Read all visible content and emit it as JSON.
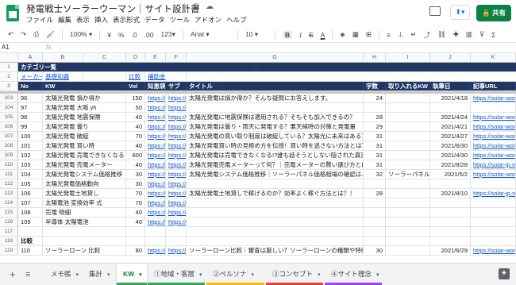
{
  "title": "発電戦士ソーラーウーマン｜サイト設計書",
  "title_icons": [
    "star-icon",
    "move-to-folder-icon",
    "cloud-saved-icon"
  ],
  "menu": [
    "ファイル",
    "編集",
    "表示",
    "挿入",
    "表示形式",
    "データ",
    "ツール",
    "アドオン",
    "ヘルプ"
  ],
  "share_label": "共有",
  "toolbar": {
    "zoom": "100%",
    "currency": "¥",
    "percent": "%",
    "dec_dec": ".0",
    "dec_inc": ".00",
    "format_more": "123",
    "font": "Arial",
    "font_size": "10",
    "bold": "B",
    "italic": "I",
    "strike": "S",
    "text_color": "A"
  },
  "name_box": "A1",
  "fx": "fx",
  "columns": [
    "A",
    "B",
    "C",
    "D",
    "E",
    "F",
    "G",
    "H",
    "I",
    "J",
    "K"
  ],
  "top_rows": {
    "r1": {
      "num": "1",
      "label": "カテゴリ一覧"
    },
    "r2": {
      "num": "2",
      "c1": "メーカー",
      "c2": "基礎知識",
      "c3": "比較",
      "c4": "補助金"
    },
    "r3": {
      "num": "3",
      "cells": [
        "No",
        "KW",
        "Vol",
        "知恵袋",
        "サブ",
        "タイトル",
        "字数",
        "取り入れるKW",
        "執筆日",
        "記事URL"
      ]
    }
  },
  "rows": [
    {
      "num": "103",
      "no": "96",
      "kw": "太陽光発電 損か得か",
      "vol": "150",
      "chie": "https://c",
      "sub": "https://v",
      "title": "太陽光発電は損か得か？そんな疑問にお答えします。",
      "chars": "24",
      "inkw": "",
      "date": "2021/4/18",
      "url": "https://solar-wor"
    },
    {
      "num": "104",
      "no": "97",
      "kw": "太陽光発電 大阪 yh",
      "vol": "50",
      "chie": "https://c",
      "sub": "https://v",
      "title": "",
      "chars": "",
      "inkw": "",
      "date": "",
      "url": ""
    },
    {
      "num": "105",
      "no": "98",
      "kw": "太陽光発電 地震保険",
      "vol": "40",
      "chie": "https://c",
      "sub": "https://v",
      "title": "太陽光発電に地震保険は適用される？そもそも加入できるの？",
      "chars": "28",
      "inkw": "",
      "date": "2021/4/24",
      "url": "https://solar-wor"
    },
    {
      "num": "106",
      "no": "99",
      "kw": "太陽光発電 曇り",
      "vol": "40",
      "chie": "https://c",
      "sub": "https://v",
      "title": "太陽光発電は曇り・雨天に発電する？悪天候時の対策と発電量",
      "chars": "29",
      "inkw": "",
      "date": "2021/4/21",
      "url": "https://solar-wor"
    },
    {
      "num": "107",
      "no": "100",
      "kw": "太陽光発電 破綻",
      "vol": "70",
      "chie": "https://c",
      "sub": "https://v",
      "title": "太陽光発電の買い取り制度は破綻している？太陽光に未来はある？",
      "chars": "31",
      "inkw": "",
      "date": "2021/4/27",
      "url": "https://solar-wor"
    },
    {
      "num": "108",
      "no": "101",
      "kw": "太陽光発電 買い時",
      "vol": "40",
      "chie": "https://c",
      "sub": "https://v",
      "title": "太陽光発電買い時の見極め方を伝授！買い時を逃さない方法とは？",
      "chars": "31",
      "inkw": "",
      "date": "2021/6/30",
      "url": "https://solar-wor"
    },
    {
      "num": "109",
      "no": "102",
      "kw": "太陽光発電 売電できなくなる",
      "vol": "600",
      "chie": "https://c",
      "sub": "https://v",
      "title": "太陽光発電は売電できなくなる!?誰も話そうとしない隠された真実",
      "chars": "31",
      "inkw": "",
      "date": "2021/4/30",
      "url": "https://solar-wor"
    },
    {
      "num": "110",
      "no": "103",
      "kw": "太陽光発電 売電メーター",
      "vol": "40",
      "chie": "https://c",
      "sub": "https://v",
      "title": "太陽光発電売電メーターって何？｜売電メーターの賢い選び方とは？",
      "chars": "31",
      "inkw": "",
      "date": "2021/8/28",
      "url": "https://solar-jp.n"
    },
    {
      "num": "111",
      "no": "104",
      "kw": "太陽光発電システム価格推移",
      "vol": "30",
      "chie": "https://c",
      "sub": "https://v",
      "title": "太陽光発電システム価格推移｜ソーラーパネル価格相場の確認はこち",
      "chars": "32",
      "inkw": "ソーラーパネル",
      "date": "2021/5/2",
      "url": "https://solar-wor"
    },
    {
      "num": "112",
      "no": "105",
      "kw": "太陽光発電価格動向",
      "vol": "30",
      "chie": "https://c",
      "sub": "https://v",
      "title": "",
      "chars": "",
      "inkw": "",
      "date": "",
      "url": ""
    },
    {
      "num": "113",
      "no": "106",
      "kw": "太陽光発電土地貸し",
      "vol": "70",
      "chie": "https://c",
      "sub": "https://v",
      "title": "太陽光発電土地貸しで稼げるのか？効率よく稼ぐ方法とは？！",
      "chars": "28",
      "inkw": "",
      "date": "2021/8/10",
      "url": "https://solar-jp.n"
    },
    {
      "num": "114",
      "no": "107",
      "kw": "太陽電池 変換効率 式",
      "vol": "70",
      "chie": "https://c",
      "sub": "https://v",
      "title": "",
      "chars": "",
      "inkw": "",
      "date": "",
      "url": ""
    },
    {
      "num": "115",
      "no": "108",
      "kw": "売電 明細",
      "vol": "40",
      "chie": "https://c",
      "sub": "https://v",
      "title": "",
      "chars": "",
      "inkw": "",
      "date": "",
      "url": ""
    },
    {
      "num": "116",
      "no": "109",
      "kw": "半導体 太陽電池",
      "vol": "40",
      "chie": "https://c",
      "sub": "https://v",
      "title": "",
      "chars": "",
      "inkw": "",
      "date": "",
      "url": ""
    },
    {
      "num": "117",
      "no": "",
      "kw": "",
      "vol": "",
      "chie": "",
      "sub": "",
      "title": "",
      "chars": "",
      "inkw": "",
      "date": "",
      "url": ""
    },
    {
      "num": "118",
      "no": "比較",
      "kw": "",
      "vol": "",
      "chie": "",
      "sub": "",
      "title": "",
      "chars": "",
      "inkw": "",
      "date": "",
      "url": ""
    },
    {
      "num": "119",
      "no": "110",
      "kw": "ソーラーローン 比較",
      "vol": "80",
      "chie": "https://c",
      "sub": "https://v",
      "title": "ソーラーローン比較｜審査は厳しい？ソーラーローンの種類や特徴",
      "chars": "30",
      "inkw": "",
      "date": "2021/6/29",
      "url": "https://solar-wor"
    }
  ],
  "tabs": [
    {
      "label": "メモ帳",
      "color": ""
    },
    {
      "label": "集計",
      "color": ""
    },
    {
      "label": "KW",
      "color": "#34a853",
      "active": true
    },
    {
      "label": "①地域・客層",
      "color": "#34a853"
    },
    {
      "label": "②ペルソナ",
      "color": "#fbbc04"
    },
    {
      "label": "③コンセプト",
      "color": "#ea4335"
    },
    {
      "label": "④サイト理念",
      "color": "#a142f4"
    }
  ],
  "colors": {
    "header_navy": "#203764",
    "share_green": "#0b8043",
    "link": "#1155cc"
  }
}
